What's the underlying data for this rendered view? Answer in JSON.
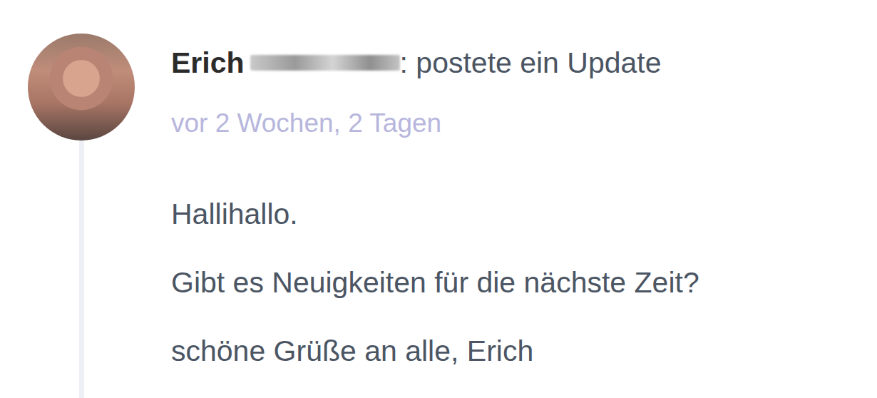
{
  "post": {
    "author": "Erich",
    "action": ": postete ein Update",
    "time": "vor 2 Wochen, 2 Tagen",
    "lines": [
      "Hallihallo.",
      "Gibt es Neuigkeiten für die nächste Zeit?",
      "schöne Grüße an alle, Erich"
    ]
  }
}
